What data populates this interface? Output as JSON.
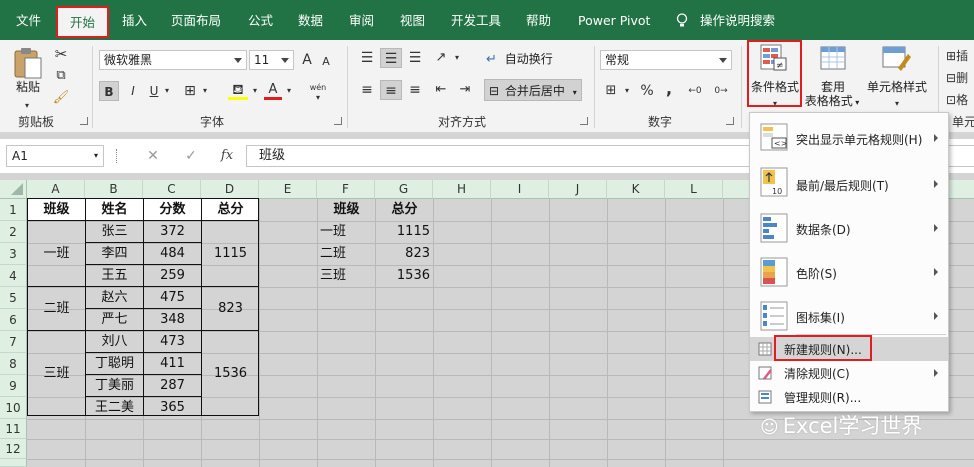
{
  "tabs": [
    "文件",
    "开始",
    "插入",
    "页面布局",
    "公式",
    "数据",
    "审阅",
    "视图",
    "开发工具",
    "帮助",
    "Power Pivot",
    "操作说明搜索"
  ],
  "ribbon": {
    "clipboard": {
      "paste_label": "粘贴",
      "group_label": "剪贴板"
    },
    "font": {
      "name": "微软雅黑",
      "size": "11",
      "bold": "B",
      "italic": "I",
      "underline": "U",
      "grow": "A",
      "shrink": "A",
      "font_color_glyph": "A",
      "phonetic": "wén",
      "group_label": "字体"
    },
    "alignment": {
      "wrap_label": "自动换行",
      "merge_label": "合并后居中",
      "group_label": "对齐方式"
    },
    "number": {
      "format": "常规",
      "percent": "%",
      "comma": ",",
      "group_label": "数字"
    },
    "styles": {
      "conditional_label": "条件格式",
      "table_label_1": "套用",
      "table_label_2": "表格格式",
      "cell_styles_label": "单元格样式",
      "right_group_label": "单元",
      "right_insert": "插",
      "right_delete": "删",
      "right_format": "格"
    }
  },
  "formula_bar": {
    "name_box": "A1",
    "fx": "fx",
    "content": "班级"
  },
  "columns": [
    "A",
    "B",
    "C",
    "D",
    "E",
    "F",
    "G",
    "H",
    "I",
    "J",
    "K",
    "L"
  ],
  "rows": [
    "1",
    "2",
    "3",
    "4",
    "5",
    "6",
    "7",
    "8",
    "9",
    "10",
    "11",
    "12"
  ],
  "table1": {
    "headers": [
      "班级",
      "姓名",
      "分数",
      "总分"
    ],
    "classes": [
      "一班",
      "二班",
      "三班"
    ],
    "names": [
      "张三",
      "李四",
      "王五",
      "赵六",
      "严七",
      "刘八",
      "丁聪明",
      "丁美丽",
      "王二美"
    ],
    "scores": [
      "372",
      "484",
      "259",
      "475",
      "348",
      "473",
      "411",
      "287",
      "365"
    ],
    "totals": [
      "1115",
      "823",
      "1536"
    ]
  },
  "table2": {
    "headers": [
      "班级",
      "总分"
    ],
    "rows": [
      [
        "一班",
        "1115"
      ],
      [
        "二班",
        "823"
      ],
      [
        "三班",
        "1536"
      ]
    ]
  },
  "menu": {
    "items": [
      {
        "label": "突出显示单元格规则(H)",
        "icon": "highlight-cells-icon"
      },
      {
        "label": "最前/最后规则(T)",
        "icon": "top-bottom-icon"
      },
      {
        "label": "数据条(D)",
        "icon": "data-bars-icon"
      },
      {
        "label": "色阶(S)",
        "icon": "color-scales-icon"
      },
      {
        "label": "图标集(I)",
        "icon": "icon-sets-icon"
      }
    ],
    "new_rule": "新建规则(N)...",
    "clear_rules": "清除规则(C)",
    "manage_rules": "管理规则(R)..."
  },
  "watermark": "Excel学习世界",
  "colors": {
    "excel_green": "#217346",
    "highlight_red": "#e31d1d",
    "header_green": "#dff0e3"
  }
}
